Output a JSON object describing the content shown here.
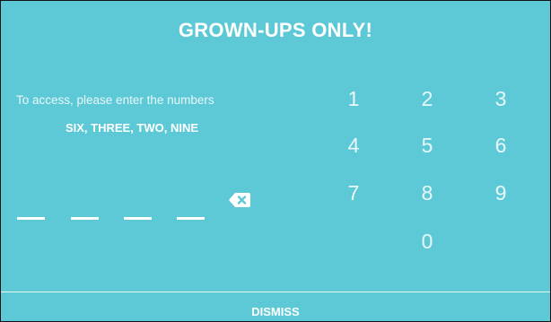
{
  "dialog": {
    "title": "GROWN-UPS ONLY!",
    "instruction": "To access, please enter the numbers",
    "code_words": "SIX, THREE, TWO, NINE",
    "entered_digits": [
      "",
      "",
      "",
      ""
    ],
    "backspace_icon": "backspace-icon",
    "keypad": {
      "keys": [
        "1",
        "2",
        "3",
        "4",
        "5",
        "6",
        "7",
        "8",
        "9",
        "0"
      ]
    },
    "dismiss_label": "DISMISS"
  },
  "colors": {
    "background": "#5ec9d6",
    "text": "#ffffff"
  }
}
